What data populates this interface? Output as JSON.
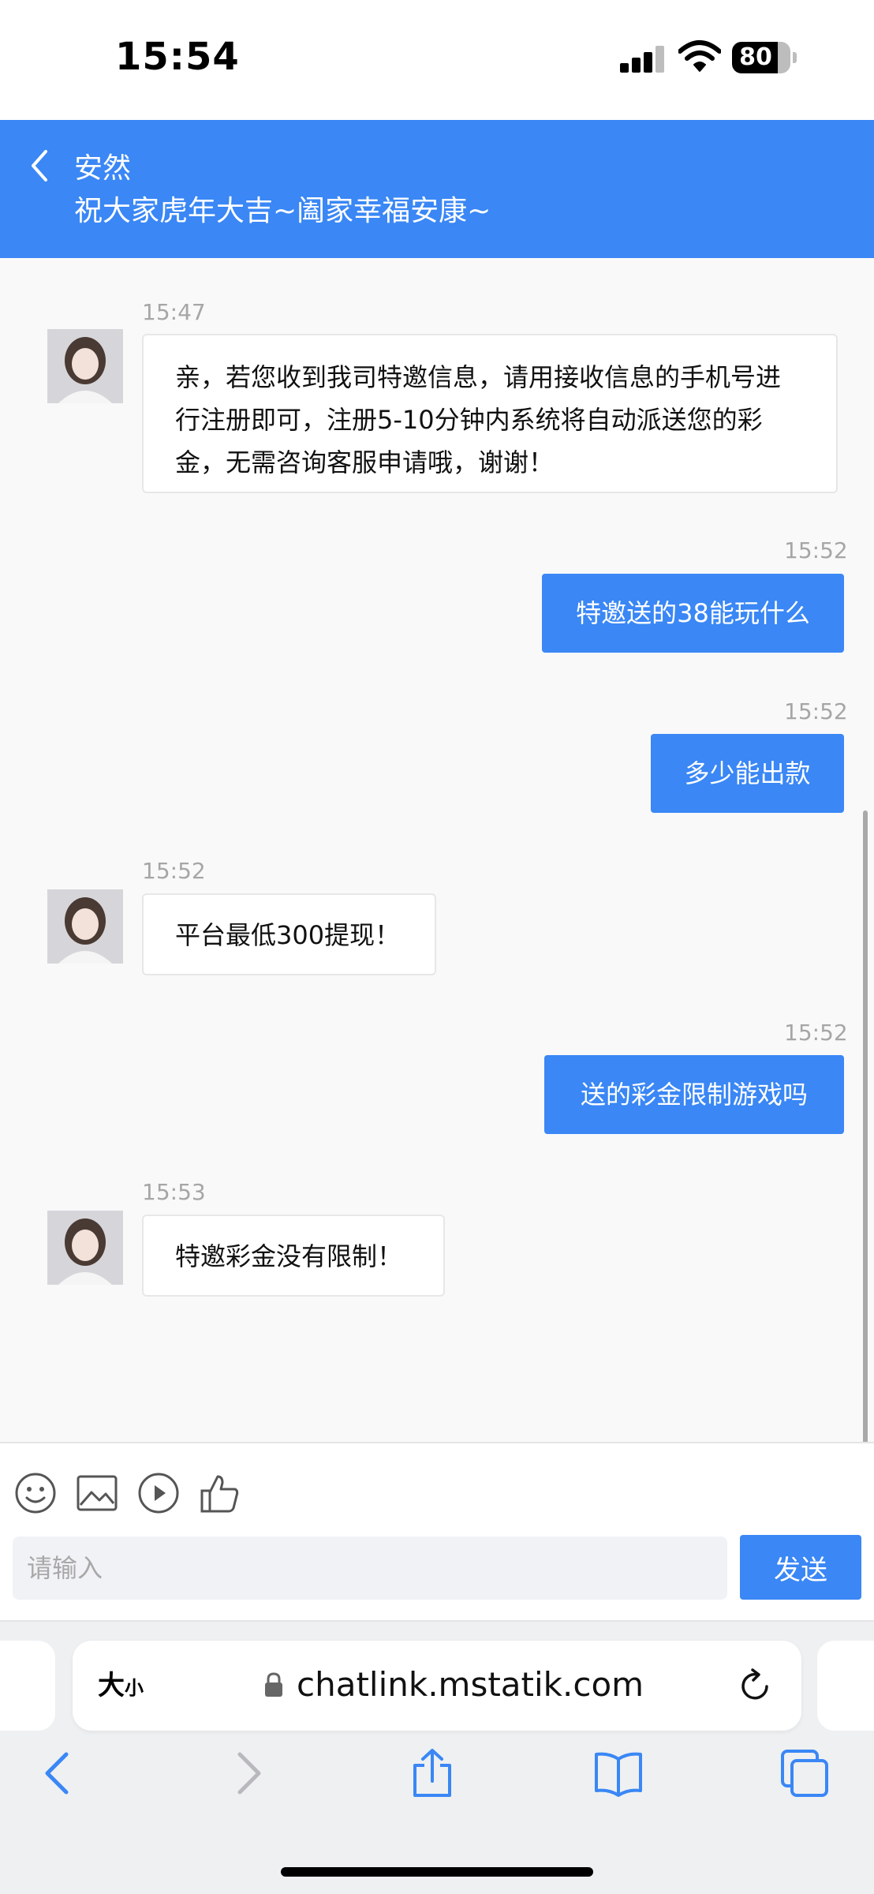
{
  "status_bar": {
    "time": "15:54",
    "battery": "80"
  },
  "header": {
    "agent_name": "安然",
    "motto": "祝大家虎年大吉~阖家幸福安康~"
  },
  "messages": [
    {
      "side": "left",
      "time": "15:47",
      "text": "亲，若您收到我司特邀信息，请用接收信息的手机号进行注册即可，注册5-10分钟内系统将自动派送您的彩金，无需咨询客服申请哦，谢谢！"
    },
    {
      "side": "right",
      "time": "15:52",
      "text": "特邀送的38能玩什么"
    },
    {
      "side": "right",
      "time": "15:52",
      "text": "多少能出款"
    },
    {
      "side": "left",
      "time": "15:52",
      "text": "平台最低300提现！"
    },
    {
      "side": "right",
      "time": "15:52",
      "text": "送的彩金限制游戏吗"
    },
    {
      "side": "left",
      "time": "15:53",
      "text": "特邀彩金没有限制！"
    }
  ],
  "input": {
    "placeholder": "请输入",
    "value": "",
    "send_label": "发送"
  },
  "browser": {
    "text_size_big": "大",
    "text_size_small": "小",
    "url": "chatlink.mstatik.com"
  },
  "colors": {
    "accent": "#3a87f5",
    "bubble_border": "#e7e7e9",
    "time_gray": "#a6a6a6"
  },
  "icons": [
    "back-icon",
    "smiley-icon",
    "image-icon",
    "play-icon",
    "thumbs-up-icon",
    "lock-icon",
    "reload-icon",
    "share-icon",
    "bookmarks-icon",
    "tabs-icon"
  ]
}
